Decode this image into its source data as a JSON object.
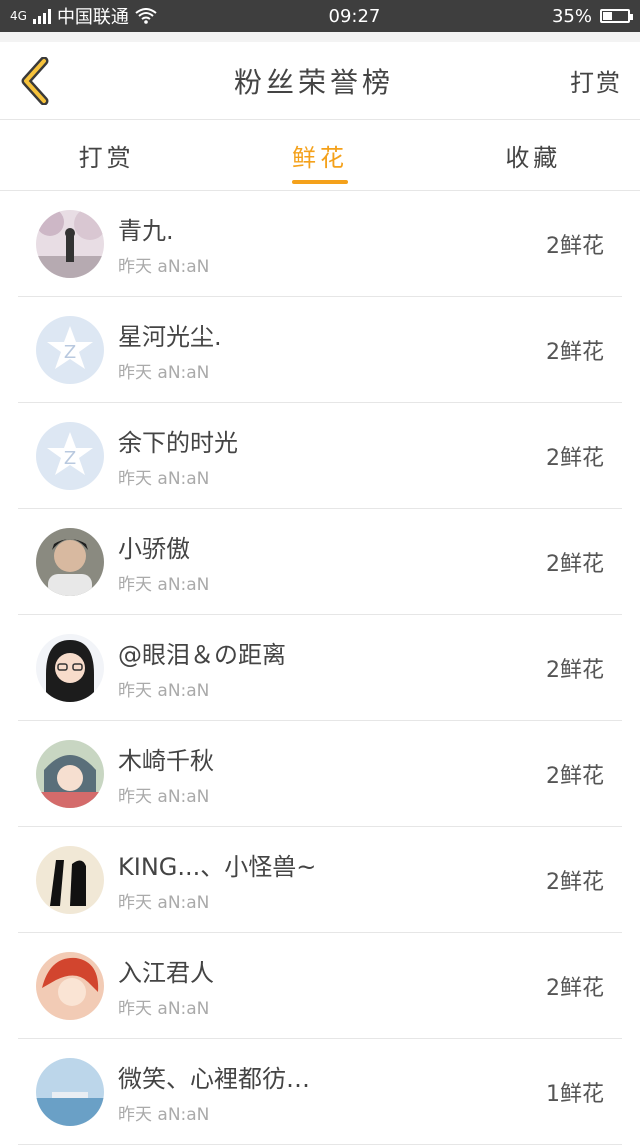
{
  "status": {
    "carrier": "中国联通",
    "network": "4G",
    "time": "09:27",
    "battery_text": "35%",
    "battery_level": 0.35
  },
  "header": {
    "title": "粉丝荣誉榜",
    "right_label": "打赏"
  },
  "tabs": [
    {
      "label": "打赏"
    },
    {
      "label": "鲜花"
    },
    {
      "label": "收藏"
    }
  ],
  "colors": {
    "accent": "#f4a11b"
  },
  "list": [
    {
      "name": "青九.",
      "time": "昨天 aN:aN",
      "count": "2鲜花",
      "avatar": "photo-avatar"
    },
    {
      "name": "星河光尘.",
      "time": "昨天 aN:aN",
      "count": "2鲜花",
      "avatar": "default-avatar"
    },
    {
      "name": "余下的时光",
      "time": "昨天 aN:aN",
      "count": "2鲜花",
      "avatar": "default-avatar"
    },
    {
      "name": "小骄傲",
      "time": "昨天 aN:aN",
      "count": "2鲜花",
      "avatar": "photo-avatar"
    },
    {
      "name": "@眼泪＆の距离",
      "time": "昨天 aN:aN",
      "count": "2鲜花",
      "avatar": "photo-avatar"
    },
    {
      "name": "木崎千秋",
      "time": "昨天 aN:aN",
      "count": "2鲜花",
      "avatar": "photo-avatar"
    },
    {
      "name": "KING...、小怪兽~",
      "time": "昨天 aN:aN",
      "count": "2鲜花",
      "avatar": "photo-avatar"
    },
    {
      "name": "入江君人",
      "time": "昨天 aN:aN",
      "count": "2鲜花",
      "avatar": "photo-avatar"
    },
    {
      "name": "微笑、心裡都彷…",
      "time": "昨天 aN:aN",
      "count": "1鲜花",
      "avatar": "photo-avatar"
    }
  ]
}
